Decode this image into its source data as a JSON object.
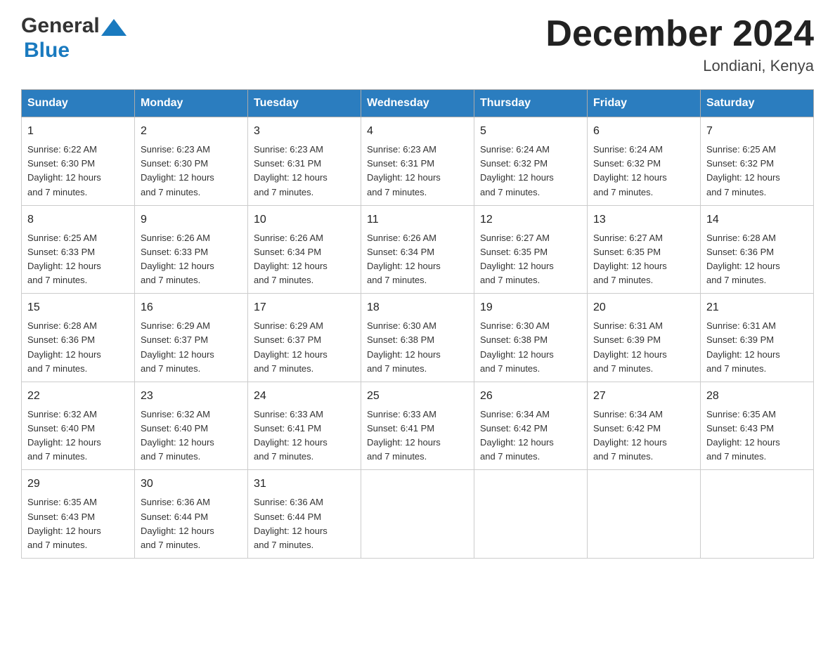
{
  "header": {
    "logo_general": "General",
    "logo_blue": "Blue",
    "month_title": "December 2024",
    "location": "Londiani, Kenya"
  },
  "days_of_week": [
    "Sunday",
    "Monday",
    "Tuesday",
    "Wednesday",
    "Thursday",
    "Friday",
    "Saturday"
  ],
  "weeks": [
    [
      {
        "day": "1",
        "sunrise": "6:22 AM",
        "sunset": "6:30 PM",
        "daylight": "12 hours and 7 minutes."
      },
      {
        "day": "2",
        "sunrise": "6:23 AM",
        "sunset": "6:30 PM",
        "daylight": "12 hours and 7 minutes."
      },
      {
        "day": "3",
        "sunrise": "6:23 AM",
        "sunset": "6:31 PM",
        "daylight": "12 hours and 7 minutes."
      },
      {
        "day": "4",
        "sunrise": "6:23 AM",
        "sunset": "6:31 PM",
        "daylight": "12 hours and 7 minutes."
      },
      {
        "day": "5",
        "sunrise": "6:24 AM",
        "sunset": "6:32 PM",
        "daylight": "12 hours and 7 minutes."
      },
      {
        "day": "6",
        "sunrise": "6:24 AM",
        "sunset": "6:32 PM",
        "daylight": "12 hours and 7 minutes."
      },
      {
        "day": "7",
        "sunrise": "6:25 AM",
        "sunset": "6:32 PM",
        "daylight": "12 hours and 7 minutes."
      }
    ],
    [
      {
        "day": "8",
        "sunrise": "6:25 AM",
        "sunset": "6:33 PM",
        "daylight": "12 hours and 7 minutes."
      },
      {
        "day": "9",
        "sunrise": "6:26 AM",
        "sunset": "6:33 PM",
        "daylight": "12 hours and 7 minutes."
      },
      {
        "day": "10",
        "sunrise": "6:26 AM",
        "sunset": "6:34 PM",
        "daylight": "12 hours and 7 minutes."
      },
      {
        "day": "11",
        "sunrise": "6:26 AM",
        "sunset": "6:34 PM",
        "daylight": "12 hours and 7 minutes."
      },
      {
        "day": "12",
        "sunrise": "6:27 AM",
        "sunset": "6:35 PM",
        "daylight": "12 hours and 7 minutes."
      },
      {
        "day": "13",
        "sunrise": "6:27 AM",
        "sunset": "6:35 PM",
        "daylight": "12 hours and 7 minutes."
      },
      {
        "day": "14",
        "sunrise": "6:28 AM",
        "sunset": "6:36 PM",
        "daylight": "12 hours and 7 minutes."
      }
    ],
    [
      {
        "day": "15",
        "sunrise": "6:28 AM",
        "sunset": "6:36 PM",
        "daylight": "12 hours and 7 minutes."
      },
      {
        "day": "16",
        "sunrise": "6:29 AM",
        "sunset": "6:37 PM",
        "daylight": "12 hours and 7 minutes."
      },
      {
        "day": "17",
        "sunrise": "6:29 AM",
        "sunset": "6:37 PM",
        "daylight": "12 hours and 7 minutes."
      },
      {
        "day": "18",
        "sunrise": "6:30 AM",
        "sunset": "6:38 PM",
        "daylight": "12 hours and 7 minutes."
      },
      {
        "day": "19",
        "sunrise": "6:30 AM",
        "sunset": "6:38 PM",
        "daylight": "12 hours and 7 minutes."
      },
      {
        "day": "20",
        "sunrise": "6:31 AM",
        "sunset": "6:39 PM",
        "daylight": "12 hours and 7 minutes."
      },
      {
        "day": "21",
        "sunrise": "6:31 AM",
        "sunset": "6:39 PM",
        "daylight": "12 hours and 7 minutes."
      }
    ],
    [
      {
        "day": "22",
        "sunrise": "6:32 AM",
        "sunset": "6:40 PM",
        "daylight": "12 hours and 7 minutes."
      },
      {
        "day": "23",
        "sunrise": "6:32 AM",
        "sunset": "6:40 PM",
        "daylight": "12 hours and 7 minutes."
      },
      {
        "day": "24",
        "sunrise": "6:33 AM",
        "sunset": "6:41 PM",
        "daylight": "12 hours and 7 minutes."
      },
      {
        "day": "25",
        "sunrise": "6:33 AM",
        "sunset": "6:41 PM",
        "daylight": "12 hours and 7 minutes."
      },
      {
        "day": "26",
        "sunrise": "6:34 AM",
        "sunset": "6:42 PM",
        "daylight": "12 hours and 7 minutes."
      },
      {
        "day": "27",
        "sunrise": "6:34 AM",
        "sunset": "6:42 PM",
        "daylight": "12 hours and 7 minutes."
      },
      {
        "day": "28",
        "sunrise": "6:35 AM",
        "sunset": "6:43 PM",
        "daylight": "12 hours and 7 minutes."
      }
    ],
    [
      {
        "day": "29",
        "sunrise": "6:35 AM",
        "sunset": "6:43 PM",
        "daylight": "12 hours and 7 minutes."
      },
      {
        "day": "30",
        "sunrise": "6:36 AM",
        "sunset": "6:44 PM",
        "daylight": "12 hours and 7 minutes."
      },
      {
        "day": "31",
        "sunrise": "6:36 AM",
        "sunset": "6:44 PM",
        "daylight": "12 hours and 7 minutes."
      },
      null,
      null,
      null,
      null
    ]
  ],
  "labels": {
    "sunrise": "Sunrise:",
    "sunset": "Sunset:",
    "daylight": "Daylight:"
  }
}
